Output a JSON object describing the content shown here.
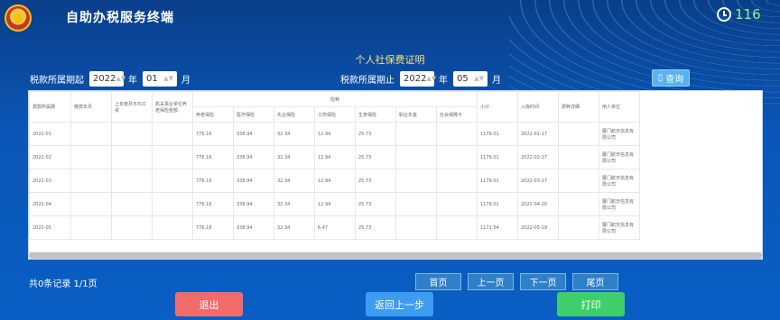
{
  "header": {
    "app_title": "自助办税服务终端",
    "countdown": "116"
  },
  "page_title": "个人社保费证明",
  "filters": {
    "start_label": "税款所属期起",
    "start_year": "2022",
    "year_unit": "年",
    "start_month": "01",
    "month_unit": "月",
    "end_label": "税款所属期止",
    "end_year": "2022",
    "end_month": "05"
  },
  "query_button": "查询",
  "table": {
    "group_header": "险种",
    "columns": [
      "费款所属期",
      "缴费年月",
      "上年度月平均工资",
      "机关事业单位养老保险金额",
      "养老保险",
      "医疗保险",
      "失业保险",
      "工伤保险",
      "生育保险",
      "职业年金",
      "社会保障卡",
      "小计",
      "入库时间",
      "费种详细",
      "用人单位"
    ],
    "rows": [
      [
        "2022-01",
        "",
        "",
        "",
        "776.16",
        "338.94",
        "32.34",
        "12.94",
        "25.73",
        "",
        "",
        "1179.01",
        "2022-01-17",
        "",
        "厦门航天信息有限公司"
      ],
      [
        "2022-02",
        "",
        "",
        "",
        "776.16",
        "338.94",
        "32.34",
        "12.94",
        "25.73",
        "",
        "",
        "1179.01",
        "2022-02-17",
        "",
        "厦门航天信息有限公司"
      ],
      [
        "2022-03",
        "",
        "",
        "",
        "776.16",
        "338.94",
        "32.34",
        "12.94",
        "25.73",
        "",
        "",
        "1179.01",
        "2022-03-17",
        "",
        "厦门航天信息有限公司"
      ],
      [
        "2022-04",
        "",
        "",
        "",
        "776.16",
        "338.94",
        "32.34",
        "12.94",
        "25.73",
        "",
        "",
        "1179.01",
        "2022-04-20",
        "",
        "厦门航天信息有限公司"
      ],
      [
        "2022-05",
        "",
        "",
        "",
        "776.16",
        "338.94",
        "32.34",
        "6.47",
        "25.73",
        "",
        "",
        "1171.54",
        "2022-05-19",
        "",
        "厦门航天信息有限公司"
      ]
    ]
  },
  "pager": {
    "summary": "共0条记录 1/1页",
    "first": "首页",
    "prev": "上一页",
    "next": "下一页",
    "last": "尾页"
  },
  "actions": {
    "exit": "退出",
    "back": "返回上一步",
    "print": "打印"
  },
  "colors": {
    "exit": "#f26b6b",
    "back": "#3d9cf0",
    "print": "#3fcf6a",
    "accent_title": "#f6e27a",
    "countdown": "#9ef07a"
  }
}
